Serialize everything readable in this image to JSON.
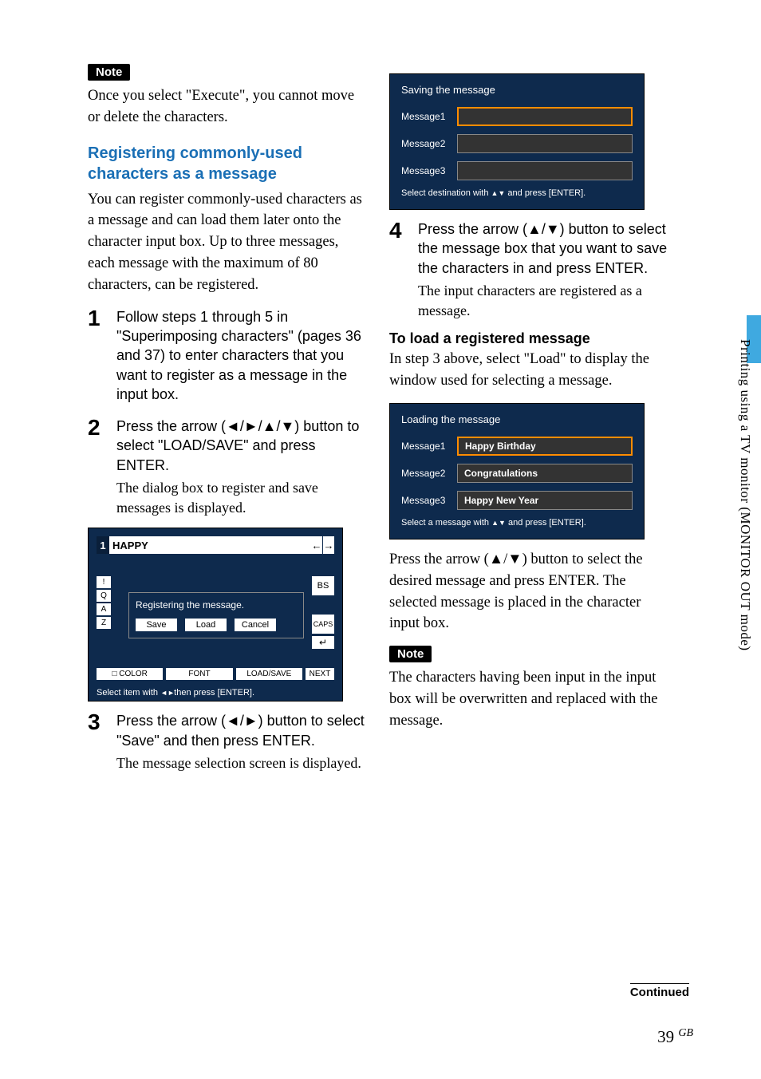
{
  "notes": {
    "label": "Note",
    "top_text": "Once you select \"Execute\", you cannot move or delete the characters.",
    "bottom_text": "The characters having been input in the input box will be overwritten and replaced with the message."
  },
  "section_heading": "Registering commonly-used characters as a message",
  "section_intro": "You can register commonly-used characters as a message and can load them later onto the character input box. Up to three messages, each message with the maximum of 80 characters, can be registered.",
  "steps": {
    "s1": {
      "num": "1",
      "title": "Follow steps 1 through 5 in \"Superimposing characters\" (pages 36 and 37) to enter characters that you want to register as a message in the input box."
    },
    "s2": {
      "num": "2",
      "title": "Press the arrow (◄/►/▲/▼) button to select \"LOAD/SAVE\" and press ENTER.",
      "sub": "The dialog box to register and save messages is displayed."
    },
    "s3": {
      "num": "3",
      "title": "Press the arrow (◄/►) button to select \"Save\" and then press ENTER.",
      "sub": "The message selection screen is displayed."
    },
    "s4": {
      "num": "4",
      "title": "Press the arrow (▲/▼) button to select the message box that you want to save the characters in and press ENTER.",
      "sub": "The input characters are registered as a message."
    }
  },
  "load_section": {
    "heading": "To load a registered message",
    "body": "In step 3 above, select \"Load\" to display the window used for selecting a message.",
    "after": "Press the arrow (▲/▼) button to select the desired message and press ENTER. The selected message is placed in the character input box."
  },
  "sim1": {
    "topbar_num": "1",
    "topbar_text": "HAPPY",
    "arrow_left": "←",
    "arrow_right": "→",
    "keys": [
      "!",
      "Q",
      "A",
      "Z"
    ],
    "bs": "BS",
    "caps": "CAPS",
    "enter": "↵",
    "dialog_title": "Registering the message.",
    "dlg_save": "Save",
    "dlg_load": "Load",
    "dlg_cancel": "Cancel",
    "tab_color": "COLOR",
    "tab_font": "FONT",
    "tab_loadsave": "LOAD/SAVE",
    "tab_next": "NEXT",
    "hint_prefix": "Select item with",
    "hint_icons": "◄►",
    "hint_suffix": "then press [ENTER]."
  },
  "sim_save": {
    "title": "Saving the message",
    "m1_lbl": "Message1",
    "m2_lbl": "Message2",
    "m3_lbl": "Message3",
    "foot_prefix": "Select destination with",
    "foot_icons": "▲▼",
    "foot_suffix": "and press [ENTER]."
  },
  "sim_load": {
    "title": "Loading the message",
    "m1_lbl": "Message1",
    "m1_val": "Happy Birthday",
    "m2_lbl": "Message2",
    "m2_val": "Congratulations",
    "m3_lbl": "Message3",
    "m3_val": "Happy New Year",
    "foot_prefix": "Select a message with",
    "foot_icons": "▲▼",
    "foot_suffix": "and press [ENTER]."
  },
  "side_text": "Printing using a TV monitor (MONITOR OUT mode)",
  "continued": "Continued",
  "page_number": "39",
  "page_region": "GB"
}
